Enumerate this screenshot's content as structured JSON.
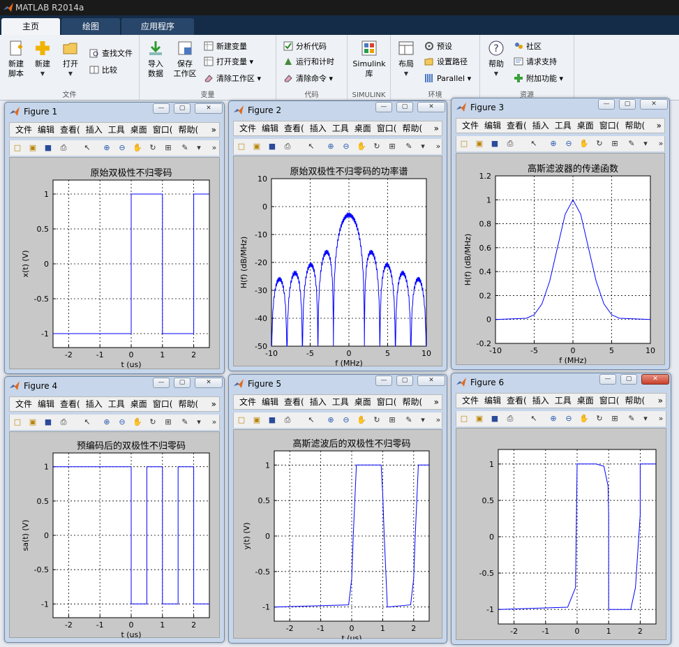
{
  "app": {
    "title": "MATLAB R2014a"
  },
  "tabs": [
    {
      "label": "主页"
    },
    {
      "label": "绘图"
    },
    {
      "label": "应用程序"
    }
  ],
  "ribbon": {
    "file": {
      "label": "文件",
      "new_script": "新建\n脚本",
      "new": "新建",
      "open": "打开",
      "find_files": "查找文件",
      "compare": "比较"
    },
    "variable": {
      "label": "变量",
      "import": "导入\n数据",
      "save_ws": "保存\n工作区",
      "new_var": "新建变量",
      "open_var": "打开变量",
      "clear_ws": "清除工作区"
    },
    "code": {
      "label": "代码",
      "analyze": "分析代码",
      "run_time": "运行和计时",
      "clear_cmd": "清除命令"
    },
    "simulink": {
      "label": "SIMULINK",
      "lib": "Simulink\n库"
    },
    "env": {
      "label": "环境",
      "layout": "布局",
      "prefs": "预设",
      "set_path": "设置路径",
      "parallel": "Parallel"
    },
    "resources": {
      "label": "资源",
      "help": "帮助",
      "community": "社区",
      "support": "请求支持",
      "addons": "附加功能"
    }
  },
  "menus": [
    "文件",
    "编辑",
    "查看(",
    "插入",
    "工具",
    "桌面",
    "窗口(",
    "帮助("
  ],
  "figures": [
    {
      "name": "Figure 1"
    },
    {
      "name": "Figure 2"
    },
    {
      "name": "Figure 3"
    },
    {
      "name": "Figure 4"
    },
    {
      "name": "Figure 5"
    },
    {
      "name": "Figure 6"
    }
  ],
  "chart_data": [
    {
      "type": "line",
      "title": "原始双极性不归零码",
      "xlabel": "t (us)",
      "ylabel": "x(t)  (V)",
      "xlim": [
        -2.5,
        2.5
      ],
      "ylim": [
        -1.2,
        1.2
      ],
      "xticks": [
        -2,
        -1,
        0,
        1,
        2
      ],
      "yticks": [
        -1,
        -0.5,
        0,
        0.5,
        1
      ],
      "grid": true,
      "series": [
        {
          "x": [
            -2.5,
            0,
            0,
            1,
            1,
            2,
            2,
            2.5
          ],
          "y": [
            -1,
            -1,
            1,
            1,
            -1,
            -1,
            1,
            1
          ]
        }
      ]
    },
    {
      "type": "line",
      "title": "原始双极性不归零码的功率谱",
      "xlabel": "f (MHz)",
      "ylabel": "H(f)  (dB/MHz)",
      "xlim": [
        -10,
        10
      ],
      "ylim": [
        -50,
        10
      ],
      "xticks": [
        -10,
        -5,
        0,
        5,
        10
      ],
      "yticks": [
        -50,
        -40,
        -30,
        -20,
        -10,
        0,
        10
      ],
      "grid": true,
      "series": [
        {
          "name": "",
          "envelope": "sinc^2",
          "peak_db": -3,
          "null_spacing_mhz": 2
        }
      ]
    },
    {
      "type": "line",
      "title": "高斯滤波器的传递函数",
      "xlabel": "f (MHz)",
      "ylabel": "H(f)  (dB/MHz)",
      "xlim": [
        -10,
        10
      ],
      "ylim": [
        -0.2,
        1.2
      ],
      "xticks": [
        -10,
        -5,
        0,
        5,
        10
      ],
      "yticks": [
        -0.2,
        0,
        0.2,
        0.4,
        0.6,
        0.8,
        1,
        1.2
      ],
      "grid": true,
      "series": [
        {
          "x": [
            -10,
            -6,
            -5,
            -4,
            -3,
            -2,
            -1,
            0,
            1,
            2,
            3,
            4,
            5,
            6,
            10
          ],
          "y": [
            0,
            0.01,
            0.04,
            0.13,
            0.32,
            0.6,
            0.88,
            1,
            0.88,
            0.6,
            0.32,
            0.13,
            0.04,
            0.01,
            0
          ]
        }
      ]
    },
    {
      "type": "line",
      "title": "预编码后的双极性不归零码",
      "xlabel": "t (us)",
      "ylabel": "sa(t)  (V)",
      "xlim": [
        -2.5,
        2.5
      ],
      "ylim": [
        -1.2,
        1.2
      ],
      "xticks": [
        -2,
        -1,
        0,
        1,
        2
      ],
      "yticks": [
        -1,
        -0.5,
        0,
        0.5,
        1
      ],
      "grid": true,
      "series": [
        {
          "x": [
            -2.5,
            0,
            0,
            0.5,
            0.5,
            1,
            1,
            1.5,
            1.5,
            2,
            2,
            2.5
          ],
          "y": [
            1,
            1,
            -1,
            -1,
            1,
            1,
            -1,
            -1,
            1,
            1,
            -1,
            -1
          ]
        }
      ]
    },
    {
      "type": "line",
      "title": "高斯滤波后的双极性不归零码",
      "xlabel": "t (us)",
      "ylabel": "y(t)  (V)",
      "xlim": [
        -2.5,
        2.5
      ],
      "ylim": [
        -1.2,
        1.2
      ],
      "xticks": [
        -2,
        -1,
        0,
        1,
        2
      ],
      "yticks": [
        -1,
        -0.5,
        0,
        0.5,
        1
      ],
      "grid": true,
      "series": [
        {
          "x": [
            -2.5,
            -0.1,
            0,
            0.05,
            0.15,
            0.95,
            1.0,
            1.05,
            1.15,
            1.9,
            2.0,
            2.05,
            2.15,
            2.5
          ],
          "y": [
            -1,
            -0.97,
            -0.6,
            0,
            1,
            1,
            0.6,
            0,
            -1,
            -0.97,
            -0.6,
            0,
            1,
            1
          ]
        }
      ]
    },
    {
      "type": "line",
      "title": "",
      "xlabel": "",
      "ylabel": "",
      "xlim": [
        -2.5,
        2.5
      ],
      "ylim": [
        -1.2,
        1.2
      ],
      "xticks": [
        -2,
        -1,
        0,
        1,
        2
      ],
      "yticks": [
        -1,
        -0.5,
        0,
        0.5,
        1
      ],
      "grid": true,
      "series": [
        {
          "x": [
            -2.5,
            -0.3,
            -0.05,
            0.0,
            0.6,
            0.85,
            0.98,
            1.0,
            1.0,
            1.7,
            1.85,
            2.0,
            2.0,
            2.5
          ],
          "y": [
            -1,
            -0.97,
            -0.7,
            1,
            1,
            0.97,
            0.7,
            0.3,
            -1,
            -1,
            -0.7,
            0.3,
            1,
            1
          ]
        }
      ]
    }
  ],
  "colors": {
    "line": "#0000ff",
    "grid": "#000000"
  }
}
